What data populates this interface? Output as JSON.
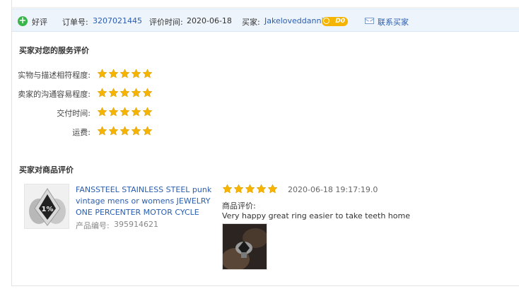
{
  "header": {
    "rating_label": "好评",
    "order_label": "订单号:",
    "order_number": "3207021445",
    "review_time_label": "评价时间:",
    "review_time": "2020-06-18",
    "buyer_label": "买家:",
    "buyer_name": "Jakeloveddannii",
    "vip_badge": "D0",
    "contact_label": "联系买家"
  },
  "service_section": {
    "title": "买家对您的服务评价",
    "rows": [
      {
        "label": "实物与描述相符程度:",
        "stars": 5
      },
      {
        "label": "卖家的沟通容易程度:",
        "stars": 5
      },
      {
        "label": "交付时间:",
        "stars": 5
      },
      {
        "label": "运费:",
        "stars": 5
      }
    ]
  },
  "product_section": {
    "title": "买家对商品评价",
    "product": {
      "title_lines": [
        "FANSSTEEL STAINLESS STEEL punk",
        "vintage mens or womens JEWELRY",
        "ONE PERCENTER MOTOR CYCLE"
      ],
      "number_label": "产品编号:",
      "number": "395914621",
      "image_text": "1%"
    },
    "review": {
      "stars": 5,
      "datetime": "2020-06-18 19:17:19.0",
      "label": "商品评价:",
      "text": "Very happy great ring easier to take teeth home"
    }
  },
  "colors": {
    "star": "#f5b400",
    "link": "#2a5db0",
    "positive": "#39b54a",
    "header_bg": "#eef4fb"
  }
}
